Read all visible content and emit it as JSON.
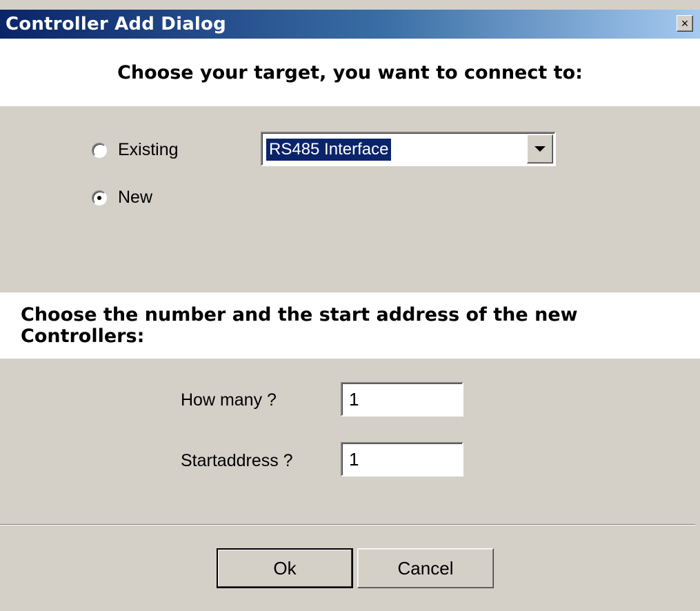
{
  "window": {
    "title": "Controller Add Dialog",
    "close_glyph": "×"
  },
  "section1": {
    "heading": "Choose your target, you want to connect to:"
  },
  "target": {
    "options": [
      {
        "label": "Existing",
        "checked": false
      },
      {
        "label": "New",
        "checked": true
      }
    ],
    "combo_value": "RS485 Interface"
  },
  "section2": {
    "heading": "Choose the number and the start address of the new Controllers:"
  },
  "fields": {
    "how_many_label": "How many ?",
    "how_many_value": "1",
    "start_label": "Startaddress ?",
    "start_value": "1"
  },
  "buttons": {
    "ok": "Ok",
    "cancel": "Cancel"
  },
  "colors": {
    "titlebar_start": "#0a246a",
    "titlebar_end": "#a6caf0",
    "dialog_bg": "#d4d0c8",
    "selection": "#0a246a"
  }
}
